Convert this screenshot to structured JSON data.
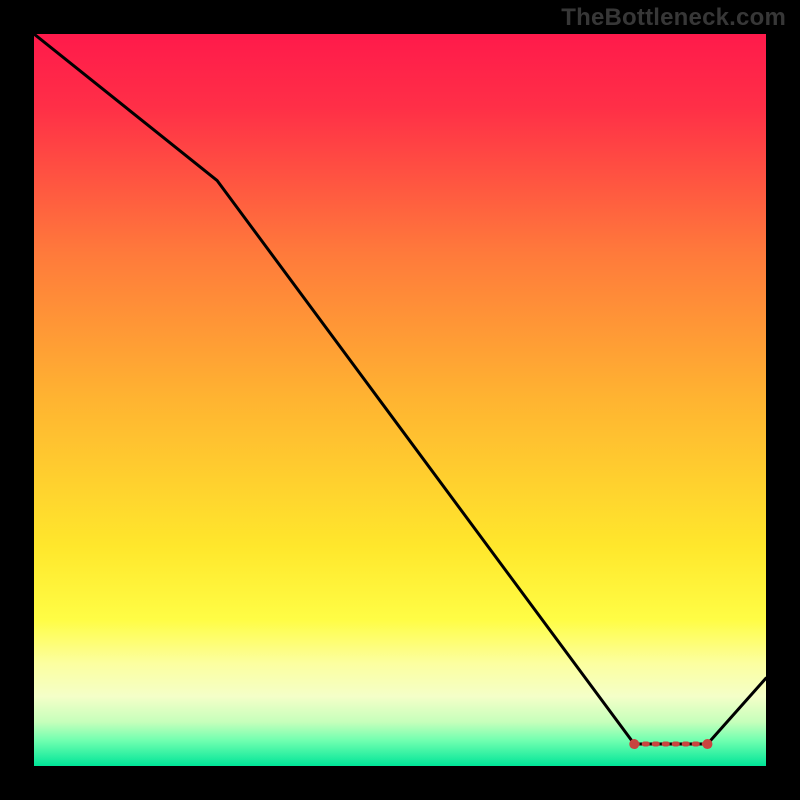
{
  "watermark": "TheBottleneck.com",
  "chart_data": {
    "type": "line",
    "title": "",
    "xlabel": "",
    "ylabel": "",
    "xlim": [
      0,
      100
    ],
    "ylim": [
      0,
      100
    ],
    "line_series": {
      "name": "curve",
      "x": [
        0,
        25,
        82,
        92,
        100
      ],
      "y": [
        100,
        80,
        3,
        3,
        12
      ]
    },
    "marker_segment": {
      "name": "flat-minimum",
      "x_start": 82,
      "x_end": 92,
      "y": 3
    },
    "gradient_stops": [
      {
        "offset": 0.0,
        "color": "#ff1a4b"
      },
      {
        "offset": 0.1,
        "color": "#ff2f47"
      },
      {
        "offset": 0.3,
        "color": "#ff7a3b"
      },
      {
        "offset": 0.5,
        "color": "#ffb431"
      },
      {
        "offset": 0.7,
        "color": "#ffe72c"
      },
      {
        "offset": 0.8,
        "color": "#fffd45"
      },
      {
        "offset": 0.86,
        "color": "#fcffa0"
      },
      {
        "offset": 0.905,
        "color": "#f4ffc8"
      },
      {
        "offset": 0.94,
        "color": "#c6ffbb"
      },
      {
        "offset": 0.965,
        "color": "#71ffb0"
      },
      {
        "offset": 1.0,
        "color": "#00e598"
      }
    ],
    "colors": {
      "line": "#000000",
      "marker_stroke": "#c9453f",
      "marker_fill": "#c9453f",
      "background": "#000000"
    }
  }
}
